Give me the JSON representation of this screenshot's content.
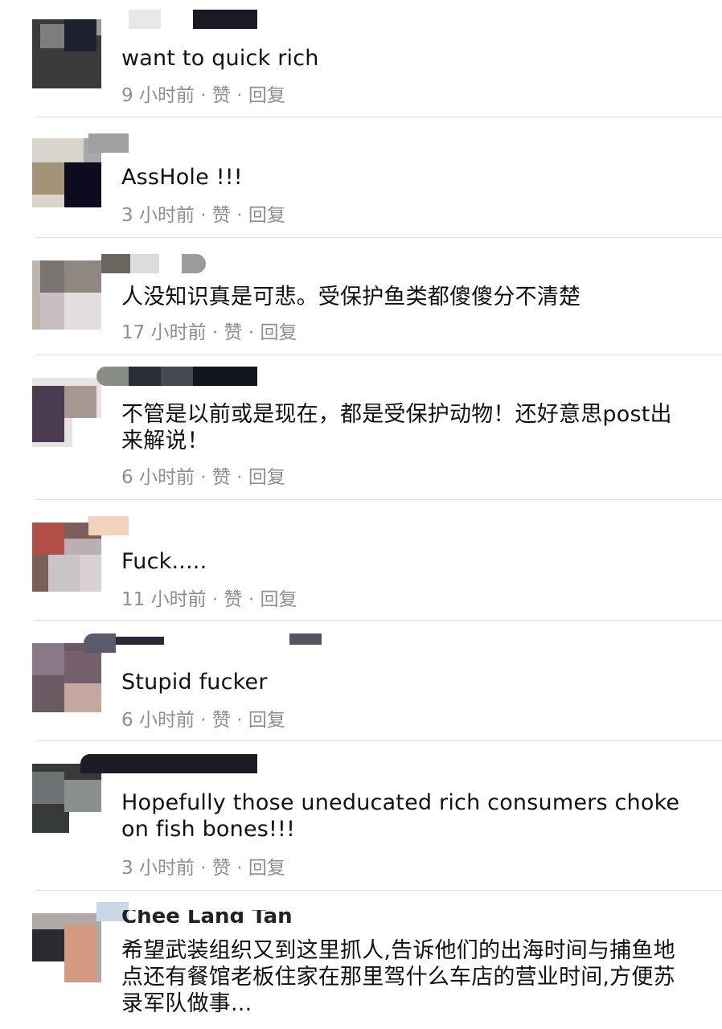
{
  "comments": [
    {
      "text": "want to quick rich",
      "time": "9 小时前",
      "like": "赞",
      "reply": "回复"
    },
    {
      "text": "AssHole !!!",
      "time": "3 小时前",
      "like": "赞",
      "reply": "回复"
    },
    {
      "text": "人没知识真是可悲。受保护鱼类都傻傻分不清楚",
      "time": "17 小时前",
      "like": "赞",
      "reply": "回复"
    },
    {
      "text": "不管是以前或是现在，都是受保护动物！还好意思post出来解说！",
      "time": "6 小时前",
      "like": "赞",
      "reply": "回复"
    },
    {
      "text": "Fuck.....",
      "time": "11 小时前",
      "like": "赞",
      "reply": "回复"
    },
    {
      "text": "Stupid fucker",
      "time": "6 小时前",
      "like": "赞",
      "reply": "回复"
    },
    {
      "text": "Hopefully those uneducated rich consumers choke on fish bones!!!",
      "time": "3 小时前",
      "like": "赞",
      "reply": "回复"
    },
    {
      "author": "Chee Lang Tan",
      "text": "希望武装组织又到这里抓人,告诉他们的出海时间与捕鱼地点还有餐馆老板住家在那里驾什么车店的营业时间,方便苏录军队做事..."
    }
  ],
  "separator": "·"
}
